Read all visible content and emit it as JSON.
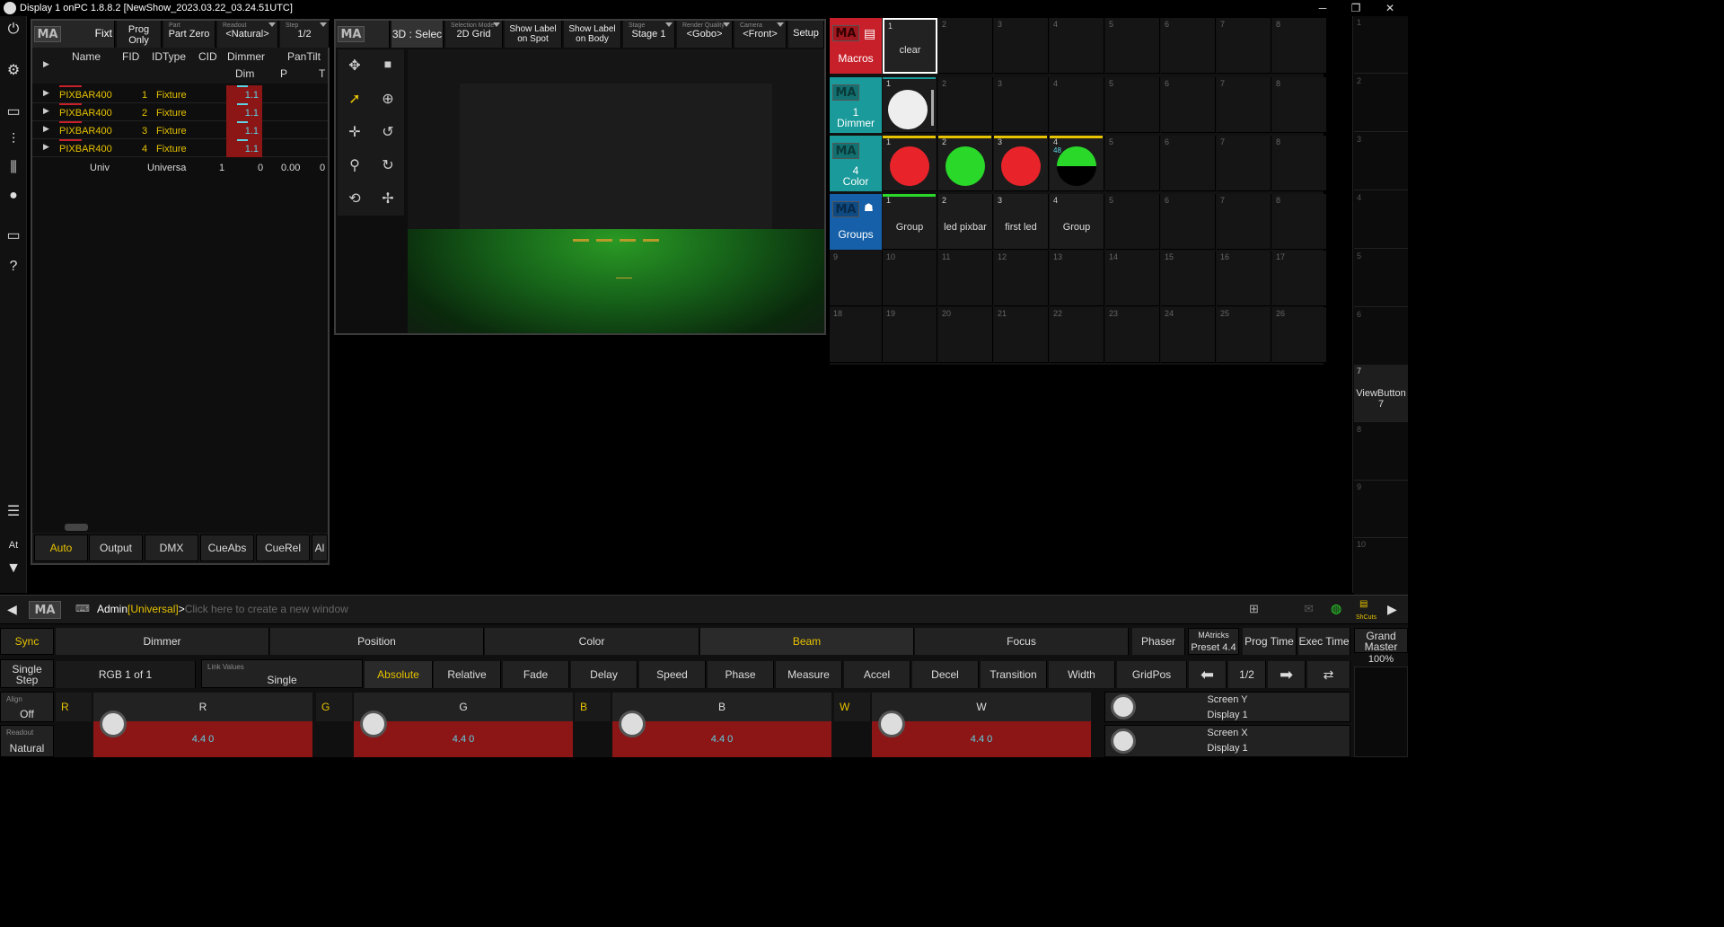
{
  "titlebar": {
    "title": "Display 1 onPC 1.8.8.2 [NewShow_2023.03.22_03.24.51UTC]",
    "minimize": "─",
    "maximize": "❐",
    "close": "✕"
  },
  "leftbar": {
    "at_label": "At"
  },
  "sheet": {
    "title": "Fixt",
    "prog_only": [
      "Prog",
      "Only"
    ],
    "part_label": "Part",
    "part_value": "Part Zero",
    "readout_label": "Readout",
    "readout_value": "<Natural>",
    "step_label": "Step",
    "step_value": "1/2",
    "columns": [
      "Name",
      "FID",
      "IDType",
      "CID",
      "Dimmer",
      "PanTilt"
    ],
    "subcolumns": [
      "Dim",
      "P",
      "T"
    ],
    "rows": [
      {
        "name": "PIXBAR400",
        "fid": "1",
        "idtype": "Fixture",
        "dim": "1.1"
      },
      {
        "name": "PIXBAR400",
        "fid": "2",
        "idtype": "Fixture",
        "dim": "1.1"
      },
      {
        "name": "PIXBAR400",
        "fid": "3",
        "idtype": "Fixture",
        "dim": "1.1"
      },
      {
        "name": "PIXBAR400",
        "fid": "4",
        "idtype": "Fixture",
        "dim": "1.1"
      }
    ],
    "univ_row": {
      "name": "Univ",
      "idtype": "Universa",
      "cid": "1",
      "dim": "0",
      "p": "0.00",
      "t": "0"
    },
    "footer_tabs": [
      "Auto",
      "Output",
      "DMX",
      "CueAbs",
      "CueRel",
      "Al"
    ]
  },
  "viewer3d": {
    "title": "3D : Selec",
    "selection_mode_label": "Selection Mode",
    "selection_mode_value": "2D Grid",
    "show_label_spot": [
      "Show Label",
      "on Spot"
    ],
    "show_label_body": [
      "Show Label",
      "on Body"
    ],
    "stage_label": "Stage",
    "stage_value": "Stage 1",
    "render_label": "Render Quality",
    "render_value": "<Gobo>",
    "camera_label": "Camera",
    "camera_value": "<Front>",
    "setup": "Setup"
  },
  "pools": {
    "macros": {
      "title": "Macros",
      "items": [
        {
          "n": "1",
          "label": "clear"
        }
      ]
    },
    "dimmer": {
      "title": "Dimmer",
      "count": "1"
    },
    "color": {
      "title": "Color",
      "count": "4",
      "extra": "48"
    },
    "groups": {
      "title": "Groups",
      "items": [
        "Group",
        "led pixbar",
        "first led",
        "Group"
      ]
    },
    "accent": {
      "macros": "#c8202a",
      "dimmer": "#1a9a9a",
      "color": "#1a9a9a",
      "groups": "#1560a8"
    }
  },
  "viewbutton": {
    "num": "7",
    "label": "ViewButton",
    "sub": "7"
  },
  "cmdline": {
    "user": "Admin",
    "universal": "[Universal]",
    "prompt": ">",
    "placeholder": "Click here to create a new window",
    "shcuts": "ShCuts"
  },
  "encoder_bar": {
    "sync": "Sync",
    "features": [
      "Dimmer",
      "Position",
      "Color",
      "Beam",
      "Focus"
    ],
    "phaser": "Phaser",
    "matricks_label": "MAtricks",
    "matricks_value": "Preset 4.4",
    "prog_time": "Prog Time",
    "exec_time": "Exec Time",
    "grand_master": [
      "Grand",
      "Master"
    ],
    "grand_value": "100%",
    "single_step": [
      "Single",
      "Step"
    ],
    "rgb": "RGB 1 of 1",
    "link_label": "Link Values",
    "link_value": "Single",
    "attrs": [
      "Absolute",
      "Relative",
      "Fade",
      "Delay",
      "Speed",
      "Phase",
      "Measure",
      "Accel",
      "Decel",
      "Transition",
      "Width",
      "GridPos"
    ],
    "page": "1/2",
    "align_label": "Align",
    "align_value": "Off",
    "readout_label": "Readout",
    "readout_value": "Natural",
    "faders": [
      {
        "letter": "R",
        "name": "R",
        "value": "4.4 0"
      },
      {
        "letter": "G",
        "name": "G",
        "value": "4.4 0"
      },
      {
        "letter": "B",
        "name": "B",
        "value": "4.4 0"
      },
      {
        "letter": "W",
        "name": "W",
        "value": "4.4 0"
      }
    ],
    "screen_y": [
      "Screen Y",
      "Display 1"
    ],
    "screen_x": [
      "Screen X",
      "Display 1"
    ]
  }
}
